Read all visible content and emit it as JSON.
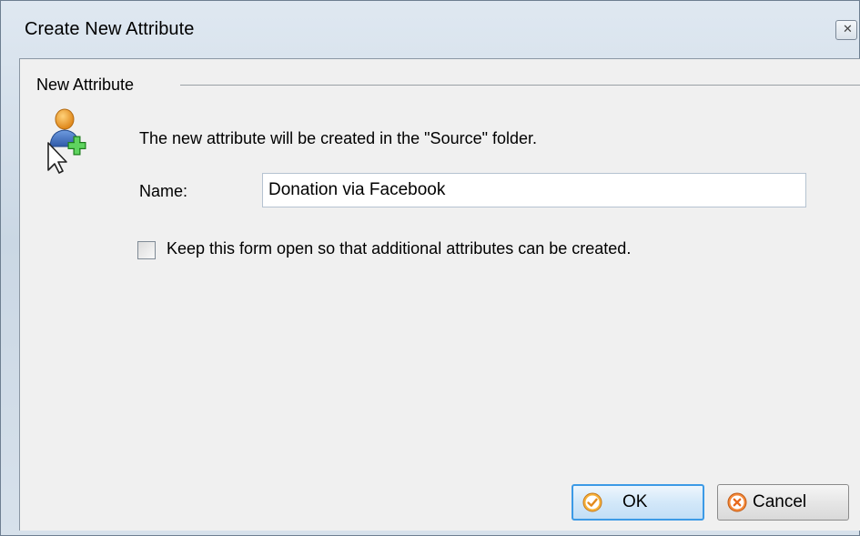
{
  "window": {
    "title": "Create New Attribute",
    "close_icon": "close-icon"
  },
  "group": {
    "legend": "New Attribute"
  },
  "info": {
    "icon": "user-add-icon",
    "text": "The new attribute will be created in the \"Source\" folder."
  },
  "name_field": {
    "label": "Name:",
    "value": "Donation via Facebook"
  },
  "keep_open": {
    "label": "Keep this form open so that additional attributes can be created.",
    "checked": false
  },
  "buttons": {
    "ok_label": "OK",
    "ok_icon": "check-circle-icon",
    "cancel_label": "Cancel",
    "cancel_icon": "cancel-circle-icon"
  },
  "colors": {
    "accent": "#3c9ae6",
    "ok_icon": "#f0a020",
    "cancel_icon": "#f07a2a",
    "plus_icon": "#3cb23c"
  }
}
